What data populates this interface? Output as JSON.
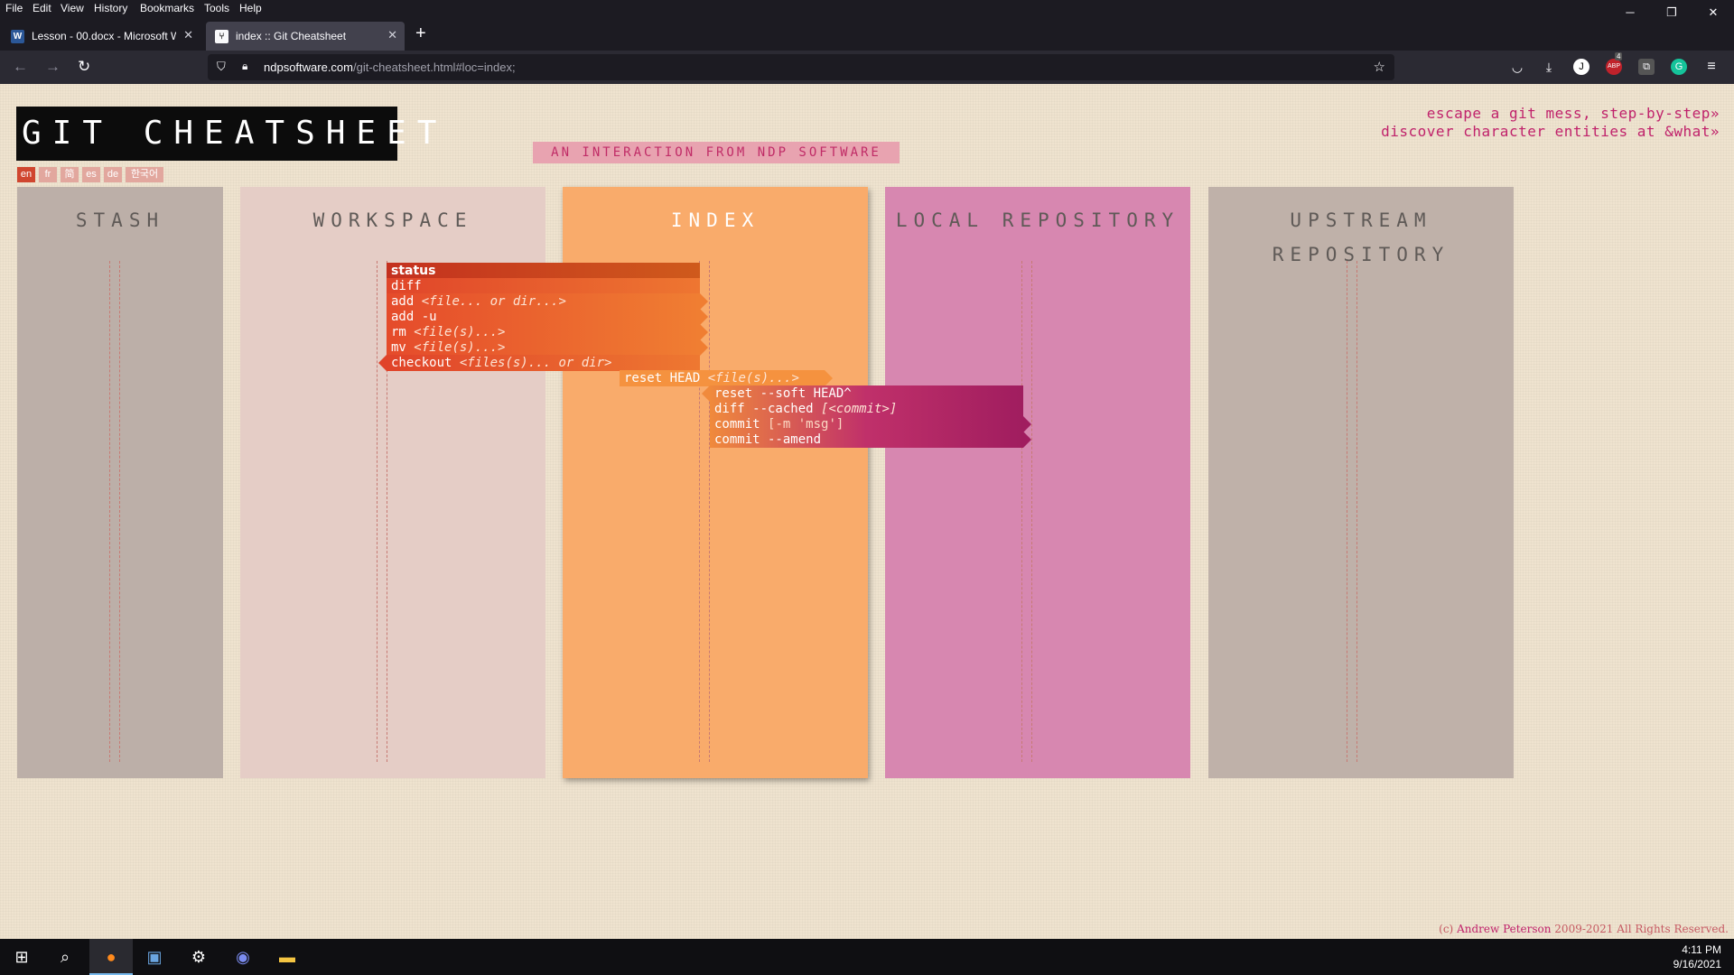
{
  "browser": {
    "menu": [
      "File",
      "Edit",
      "View",
      "History",
      "Bookmarks",
      "Tools",
      "Help"
    ],
    "menu_keys": [
      "F",
      "E",
      "V",
      "H",
      "B",
      "T",
      "H"
    ],
    "tabs": [
      {
        "title": "Lesson - 00.docx - Microsoft W",
        "icon": "word-icon",
        "active": false
      },
      {
        "title": "index :: Git Cheatsheet",
        "icon": "cheatsheet-icon",
        "active": true
      }
    ],
    "url_host": "ndpsoftware.com",
    "url_path": "/git-cheatsheet.html#loc=index;",
    "window_controls": {
      "minimize": "─",
      "restore": "❐",
      "close": "✕"
    },
    "new_tab_label": "+",
    "tab_close": "✕",
    "adblock_badge": "4"
  },
  "page": {
    "logo": "GIT CHEATSHEET",
    "subtitle": "AN INTERACTION FROM NDP SOFTWARE",
    "links": [
      "escape a git mess, step-by-step»",
      "discover character entities at &what»"
    ],
    "languages": [
      "en",
      "fr",
      "简",
      "es",
      "de",
      "한국어"
    ],
    "selected_language": "en",
    "columns": [
      {
        "key": "stash",
        "title": "STASH",
        "color": "#bcafa8"
      },
      {
        "key": "workspace",
        "title": "WORKSPACE",
        "color": "#e5cdc6"
      },
      {
        "key": "index",
        "title": "INDEX",
        "color": "#f9ab6b"
      },
      {
        "key": "local",
        "title": "LOCAL REPOSITORY",
        "color": "#d787b0"
      },
      {
        "key": "upstream",
        "title": "UPSTREAM REPOSITORY",
        "color": "#bfb1a9"
      }
    ],
    "commands": [
      {
        "name": "status",
        "args": "",
        "bold": true
      },
      {
        "name": "diff",
        "args": ""
      },
      {
        "name": "add",
        "args": "<file... or dir...>"
      },
      {
        "name": "add -u",
        "args": ""
      },
      {
        "name": "rm",
        "args": "<file(s)...>"
      },
      {
        "name": "mv",
        "args": "<file(s)...>"
      },
      {
        "name": "checkout",
        "args": "<files(s)... or dir>"
      },
      {
        "name": "reset HEAD",
        "args": "<file(s)...>"
      },
      {
        "name": "reset --soft HEAD^",
        "args": ""
      },
      {
        "name": "diff --cached",
        "args": "[<commit>]"
      },
      {
        "name": "commit",
        "args": "[-m 'msg']"
      },
      {
        "name": "commit --amend",
        "args": ""
      }
    ],
    "copyright_prefix": "(c) ",
    "copyright_author": "Andrew Peterson",
    "copyright_suffix": " 2009-2021 All Rights Reserved."
  },
  "taskbar": {
    "time": "4:11 PM",
    "date": "9/16/2021",
    "apps": [
      "start-icon",
      "search-icon",
      "firefox-icon",
      "control-panel-icon",
      "settings-icon",
      "discord-icon",
      "file-explorer-icon"
    ]
  },
  "colors": {
    "accent": "#c0226b",
    "status": "#c4301f"
  }
}
